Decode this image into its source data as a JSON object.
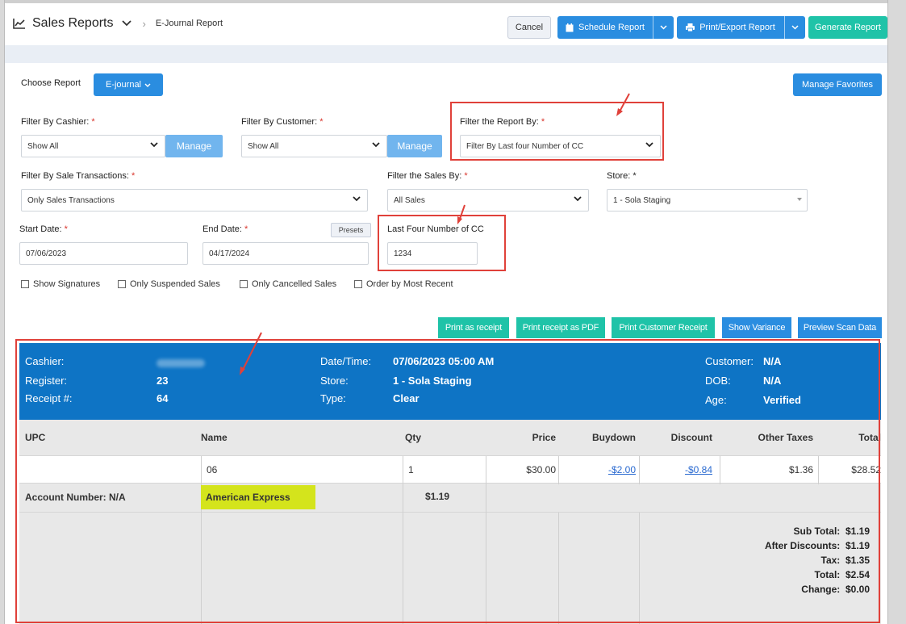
{
  "header": {
    "app_title": "Sales Reports",
    "breadcrumb_sub": "E-Journal Report",
    "cancel_label": "Cancel",
    "schedule_label": "Schedule Report",
    "print_export_label": "Print/Export Report",
    "generate_label": "Generate Report"
  },
  "choose": {
    "label": "Choose Report",
    "selected": "E-journal",
    "manage_favorites": "Manage Favorites"
  },
  "filters": {
    "cashier_label": "Filter By Cashier:",
    "cashier_value": "Show All",
    "customer_label": "Filter By Customer:",
    "customer_value": "Show All",
    "manage_label": "Manage",
    "report_by_label": "Filter the Report By:",
    "report_by_value": "Filter By Last four Number of CC",
    "sale_tx_label": "Filter By Sale Transactions:",
    "sale_tx_value": "Only Sales Transactions",
    "sales_by_label": "Filter the Sales By:",
    "sales_by_value": "All Sales",
    "store_label": "Store:",
    "store_value": "1 - Sola Staging",
    "start_label": "Start Date:",
    "start_value": "07/06/2023",
    "end_label": "End Date:",
    "end_value": "04/17/2024",
    "presets_label": "Presets",
    "last_four_label": "Last Four Number of CC",
    "last_four_value": "1234",
    "required_mark": "*"
  },
  "checkboxes": [
    "Show Signatures",
    "Only Suspended Sales",
    "Only Cancelled Sales",
    "Order by Most Recent"
  ],
  "actions": {
    "print_receipt": "Print as receipt",
    "print_pdf": "Print receipt as PDF",
    "print_customer": "Print Customer Receipt",
    "show_variance": "Show Variance",
    "preview_scan": "Preview Scan Data"
  },
  "receipt": {
    "cashier_label": "Cashier:",
    "register_label": "Register:",
    "register_value": "23",
    "receipt_label": "Receipt #:",
    "receipt_value": "64",
    "datetime_label": "Date/Time:",
    "datetime_value": "07/06/2023 05:00 AM",
    "store_label": "Store:",
    "store_value": "1 - Sola Staging",
    "type_label": "Type:",
    "type_value": "Clear",
    "customer_label": "Customer:",
    "customer_value": "N/A",
    "dob_label": "DOB:",
    "dob_value": "N/A",
    "age_label": "Age:",
    "age_value": "Verified"
  },
  "table": {
    "headers": [
      "UPC",
      "Name",
      "Qty",
      "Price",
      "Buydown",
      "Discount",
      "Other Taxes",
      "Total"
    ],
    "row": {
      "upc": "",
      "name": "06",
      "qty": "1",
      "price": "$30.00",
      "buydown": "-$2.00",
      "discount": "-$0.84",
      "other_taxes": "$1.36",
      "total": "$28.52"
    },
    "account_label": "Account Number: N/A",
    "payment_type": "American Express",
    "payment_amount": "$1.19"
  },
  "totals": {
    "sub_total_label": "Sub Total:",
    "sub_total": "$1.19",
    "after_discounts_label": "After Discounts:",
    "after_discounts": "$1.19",
    "tax_label": "Tax:",
    "tax": "$1.35",
    "total_label": "Total:",
    "total": "$2.54",
    "change_label": "Change:",
    "change": "$0.00"
  },
  "colors": {
    "accent_blue": "#2a8de0",
    "accent_teal": "#1fc3a8",
    "receipt_blue": "#0e74c5",
    "highlight": "#d4e41c",
    "annotation_red": "#e0413a"
  }
}
